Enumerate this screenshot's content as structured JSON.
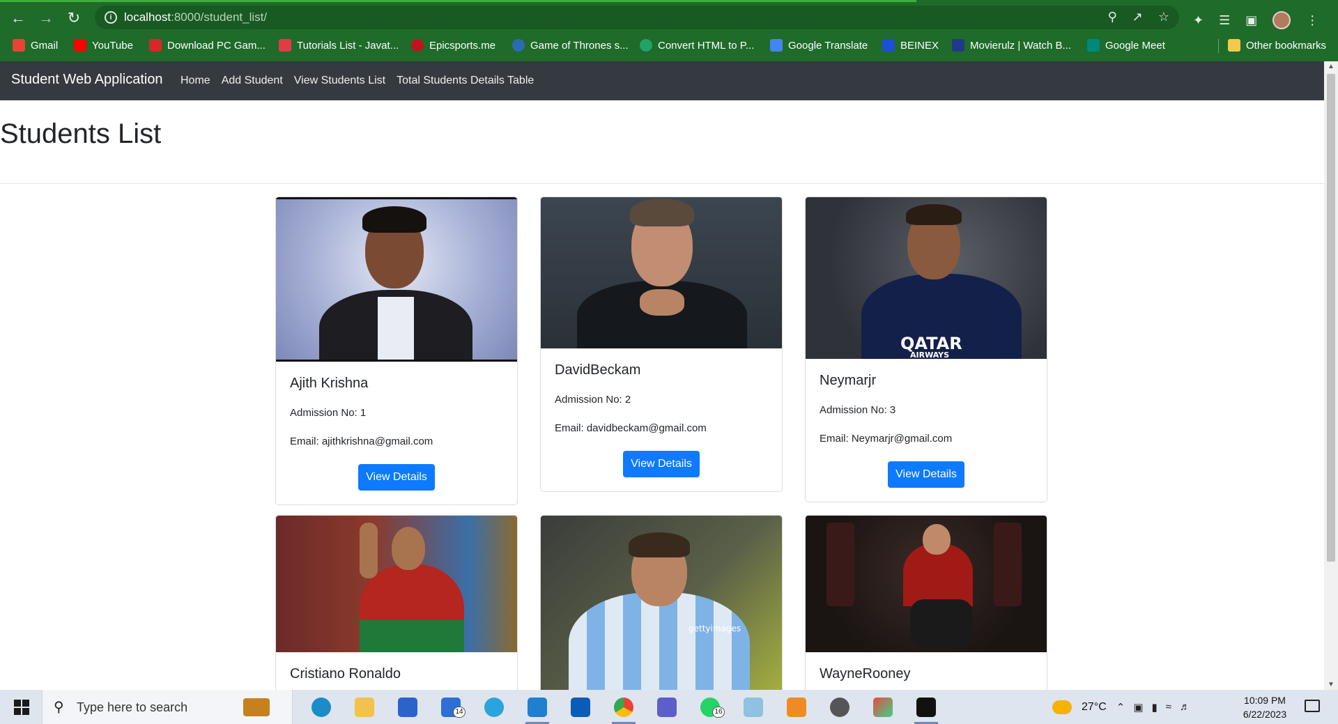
{
  "browser": {
    "url_host": "localhost",
    "url_path": ":8000/student_list/",
    "bookmarks": [
      {
        "label": "Gmail",
        "color": "#ea4335"
      },
      {
        "label": "YouTube",
        "color": "#ff0000"
      },
      {
        "label": "Download PC Gam...",
        "color": "#d62828"
      },
      {
        "label": "Tutorials List - Javat...",
        "color": "#e63946"
      },
      {
        "label": "Epicsports.me",
        "color": "#c1121f"
      },
      {
        "label": "Game of Thrones s...",
        "color": "#2b6cb0"
      },
      {
        "label": "Convert HTML to P...",
        "color": "#21a366"
      },
      {
        "label": "Google Translate",
        "color": "#4285f4"
      },
      {
        "label": "BEINEX",
        "color": "#1d4ed8"
      },
      {
        "label": "Movierulz | Watch B...",
        "color": "#1e3a8a"
      },
      {
        "label": "Google Meet",
        "color": "#00897b"
      }
    ],
    "other_bookmarks": "Other bookmarks"
  },
  "navbar": {
    "brand": "Student Web Application",
    "links": [
      "Home",
      "Add Student",
      "View Students List",
      "Total Students Details Table"
    ]
  },
  "page": {
    "title": "Students List"
  },
  "students": [
    {
      "name": "Ajith Krishna",
      "admission": "Admission No: 1",
      "email": "Email: ajithkrishna@gmail.com",
      "button": "View Details"
    },
    {
      "name": "DavidBeckam",
      "admission": "Admission No: 2",
      "email": "Email: davidbeckam@gmail.com",
      "button": "View Details"
    },
    {
      "name": "Neymarjr",
      "admission": "Admission No: 3",
      "email": "Email: Neymarjr@gmail.com",
      "button": "View Details",
      "photo_text": "QATAR",
      "photo_subtext": "AIRWAYS"
    },
    {
      "name": "Cristiano Ronaldo"
    },
    {
      "name": "",
      "photo_text": "gettyimages"
    },
    {
      "name": "WayneRooney"
    }
  ],
  "taskbar": {
    "search_placeholder": "Type here to search",
    "badge_mail": "14",
    "badge_whatsapp": "16",
    "temperature": "27°C",
    "time": "10:09 PM",
    "date": "6/22/2023"
  },
  "colors": {
    "chrome": "#1f6b2a",
    "navbar": "#343a40",
    "button": "#0d7aff"
  }
}
